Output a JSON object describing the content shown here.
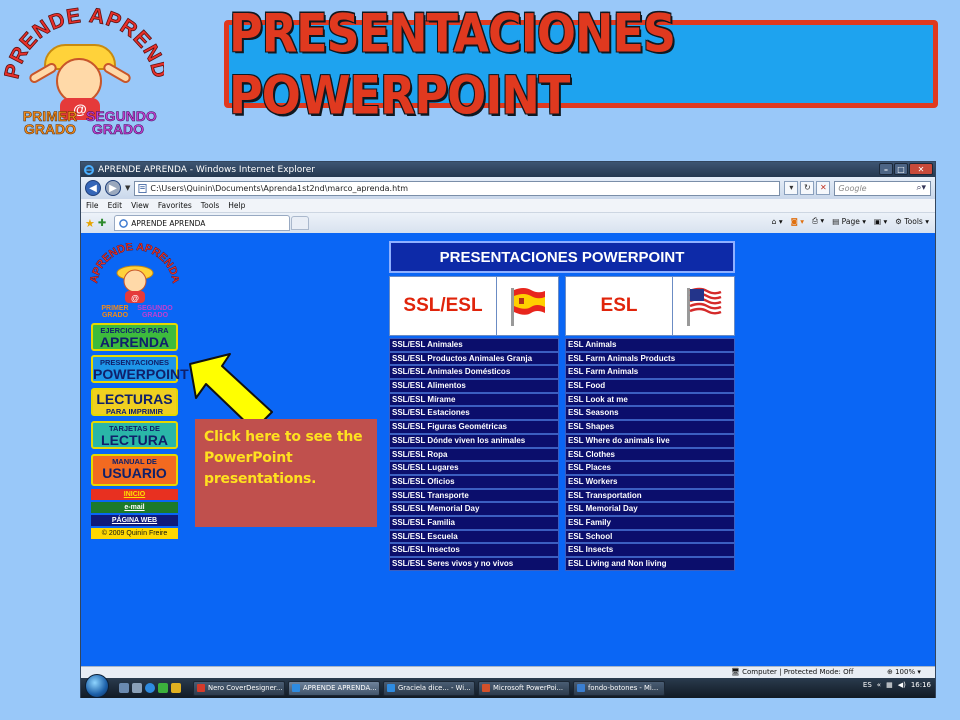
{
  "slide": {
    "title": "PRESENTACIONES POWERPOINT",
    "logo": {
      "brand": "APRENDE APRENDA",
      "grade1": "PRIMER GRADO",
      "grade2": "SEGUNDO GRADO"
    },
    "callout": "Click here to see the PowerPoint presentations."
  },
  "browser": {
    "window_title": "APRENDE APRENDA - Windows Internet Explorer",
    "address": "C:\\Users\\Quinin\\Documents\\Aprenda1st2nd\\marco_aprenda.htm",
    "search_placeholder": "Google",
    "menu": [
      "File",
      "Edit",
      "View",
      "Favorites",
      "Tools",
      "Help"
    ],
    "tab_title": "APRENDE APRENDA",
    "commands": {
      "page": "Page",
      "tools": "Tools"
    },
    "status": {
      "mode": "Computer | Protected Mode: Off",
      "zoom": "100%"
    }
  },
  "site": {
    "logo_brand": "APRENDE APRENDA",
    "logo_grade1": "PRIMER GRADO",
    "logo_grade2": "SEGUNDO GRADO",
    "nav": [
      {
        "small": "EJERCICIOS PARA",
        "big": "APRENDA",
        "color": "#3dbb3d"
      },
      {
        "small": "PRESENTACIONES",
        "big": "POWERPOINT",
        "color": "#1e96e8"
      },
      {
        "small": "PARA IMPRIMIR",
        "big": "LECTURAS",
        "color": "#f0d020"
      },
      {
        "small": "TARJETAS DE",
        "big": "LECTURA",
        "color": "#2ab6a8"
      },
      {
        "small": "MANUAL DE",
        "big": "USUARIO",
        "color": "#f26a20"
      }
    ],
    "links": [
      {
        "label": "INICIO",
        "bg": "#e83020",
        "fg": "#ffe000"
      },
      {
        "label": "e-mail",
        "bg": "#1c7a2a",
        "fg": "#ffffff"
      },
      {
        "label": "PÁGINA WEB",
        "bg": "#101a7a",
        "fg": "#ffffff"
      },
      {
        "label": "© 2009 Quinín Freire",
        "bg": "#ffd800",
        "fg": "#111111"
      }
    ],
    "table": {
      "header": "PRESENTACIONES POWERPOINT",
      "col1_title": "SSL/ESL",
      "col2_title": "ESL",
      "col1": [
        "SSL/ESL Animales",
        "SSL/ESL Productos Animales Granja",
        "SSL/ESL Animales Domésticos",
        "SSL/ESL Alimentos",
        "SSL/ESL Mírame",
        "SSL/ESL Estaciones",
        "SSL/ESL Figuras Geométricas",
        "SSL/ESL Dónde viven los animales",
        "SSL/ESL Ropa",
        "SSL/ESL Lugares",
        "SSL/ESL Oficios",
        "SSL/ESL Transporte",
        "SSL/ESL Memorial Day",
        "SSL/ESL Familia",
        "SSL/ESL Escuela",
        "SSL/ESL Insectos",
        "SSL/ESL Seres vivos y no vivos"
      ],
      "col2": [
        "ESL Animals",
        "ESL Farm Animals Products",
        "ESL Farm Animals",
        "ESL Food",
        "ESL Look at me",
        "ESL Seasons",
        "ESL Shapes",
        "ESL Where do animals live",
        "ESL Clothes",
        "ESL Places",
        "ESL Workers",
        "ESL Transportation",
        "ESL Memorial Day",
        "ESL Family",
        "ESL School",
        "ESL Insects",
        "ESL Living and Non living"
      ]
    }
  },
  "taskbar": {
    "buttons": [
      {
        "label": "Nero CoverDesigner...",
        "icon_color": "#d43a2a"
      },
      {
        "label": "APRENDE APRENDA...",
        "icon_color": "#2e8be0"
      },
      {
        "label": "Graciela dice... - Wi...",
        "icon_color": "#2e8be0"
      },
      {
        "label": "Microsoft PowerPoi...",
        "icon_color": "#d2502a"
      },
      {
        "label": "fondo-botones - Mi...",
        "icon_color": "#3a7ed0"
      }
    ],
    "lang": "ES",
    "time": "16:16"
  }
}
